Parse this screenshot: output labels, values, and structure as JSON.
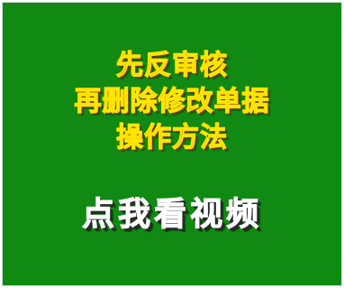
{
  "banner": {
    "title_lines": [
      "先反审核",
      "再删除修改单据",
      "操作方法"
    ],
    "cta_label": "点我看视频"
  },
  "colors": {
    "background": "#108a12",
    "title_fill": "#ff1a00",
    "title_outline": "#ffe400",
    "cta_fill": "#ffffff"
  }
}
